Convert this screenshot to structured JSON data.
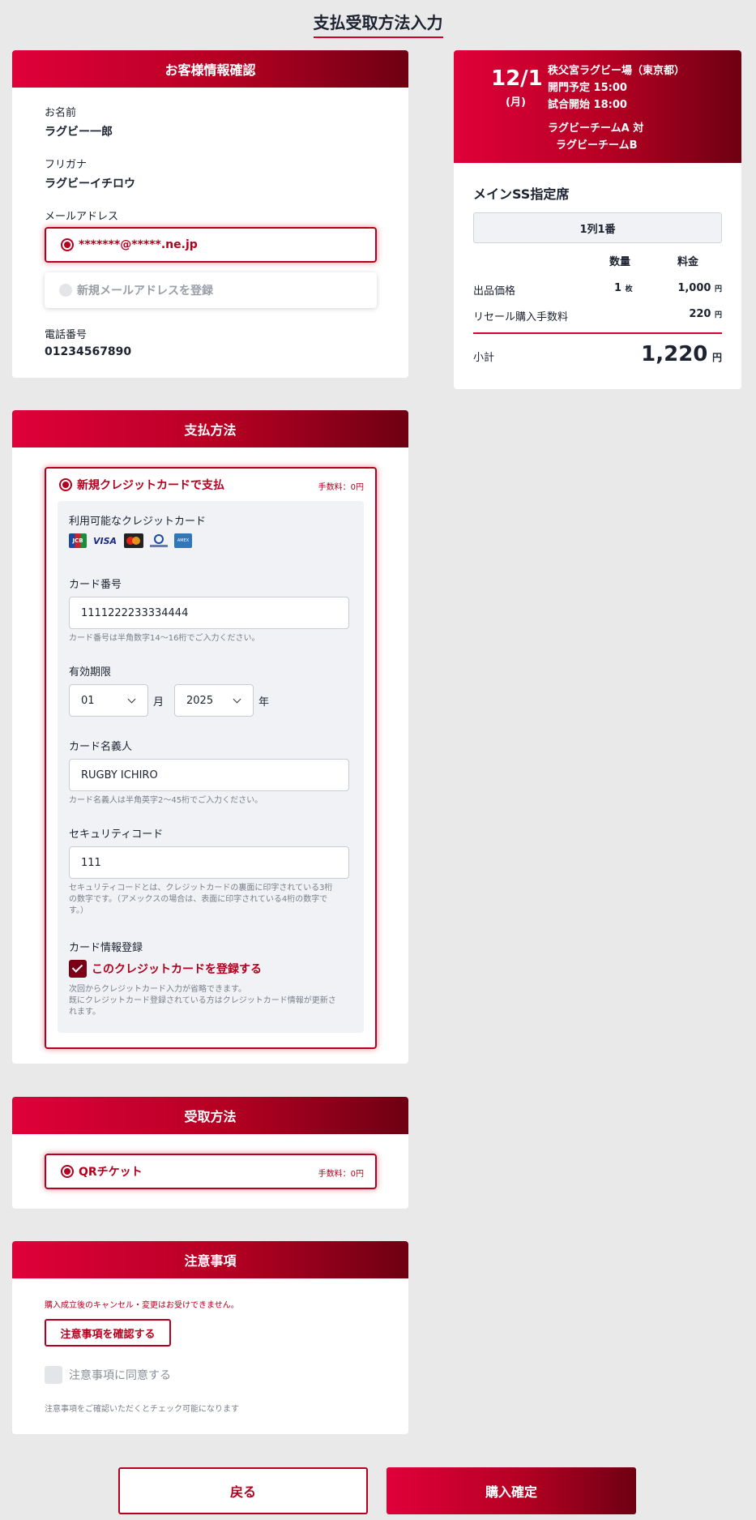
{
  "page_title": "支払受取方法入力",
  "customer": {
    "header": "お客様情報確認",
    "name_label": "お名前",
    "name_value": "ラグビー一郎",
    "furigana_label": "フリガナ",
    "furigana_value": "ラグビーイチロウ",
    "email_label": "メールアドレス",
    "email_selected": "*******@*****.ne.jp",
    "email_new": "新規メールアドレスを登録",
    "phone_label": "電話番号",
    "phone_value": "01234567890"
  },
  "event": {
    "date": "12/1",
    "weekday": "(月)",
    "venue": "秩父宮ラグビー場（東京都）",
    "open_time": "開門予定 15:00",
    "start_time": "試合開始 18:00",
    "team_a": "ラグビーチームA 対",
    "team_b": "ラグビーチームB",
    "seat_type": "メインSS指定席",
    "seat": "1列1番",
    "col_qty": "数量",
    "col_price": "料金",
    "row1_label": "出品価格",
    "row1_qty": "1",
    "row1_qty_unit": "枚",
    "row1_price": "1,000",
    "row2_label": "リセール購入手数料",
    "row2_price": "220",
    "yen": "円",
    "subtotal_label": "小計",
    "subtotal_value": "1,220"
  },
  "payment": {
    "header": "支払方法",
    "option_label": "新規クレジットカードで支払",
    "option_fee": "手数料：0円",
    "cards_label": "利用可能なクレジットカード",
    "card_brands": [
      "JCB",
      "VISA",
      "MC",
      "DC",
      "AMEX"
    ],
    "card_number_label": "カード番号",
    "card_number_value": "1111222233334444",
    "card_number_hint": "カード番号は半角数字14〜16桁でご入力ください。",
    "expiry_label": "有効期限",
    "expiry_month": "01",
    "month_unit": "月",
    "expiry_year": "2025",
    "year_unit": "年",
    "holder_label": "カード名義人",
    "holder_value": "RUGBY ICHIRO",
    "holder_hint": "カード名義人は半角英字2〜45桁でご入力ください。",
    "cvc_label": "セキュリティコード",
    "cvc_value": "111",
    "cvc_hint1": "セキュリティコードとは、クレジットカードの裏面に印字されている3桁",
    "cvc_hint2": "の数字です。（アメックスの場合は、表面に印字されている4桁の数字で",
    "cvc_hint3": "す。）",
    "register_label": "カード情報登録",
    "register_checkbox": "このクレジットカードを登録する",
    "register_hint1": "次回からクレジットカード入力が省略できます。",
    "register_hint2": "既にクレジットカード登録されている方はクレジットカード情報が更新さ",
    "register_hint3": "れます。"
  },
  "receive": {
    "header": "受取方法",
    "option_label": "QRチケット",
    "option_fee": "手数料：0円"
  },
  "notes": {
    "header": "注意事項",
    "warning": "購入成立後のキャンセル・変更はお受けできません。",
    "confirm_button": "注意事項を確認する",
    "agree_label": "注意事項に同意する",
    "agree_hint": "注意事項をご確認いただくとチェック可能になります"
  },
  "actions": {
    "back": "戻る",
    "purchase": "購入確定"
  },
  "colors": {
    "accent": "#b4001e",
    "gradient_start": "#e0003a",
    "gradient_end": "#6e0012"
  }
}
